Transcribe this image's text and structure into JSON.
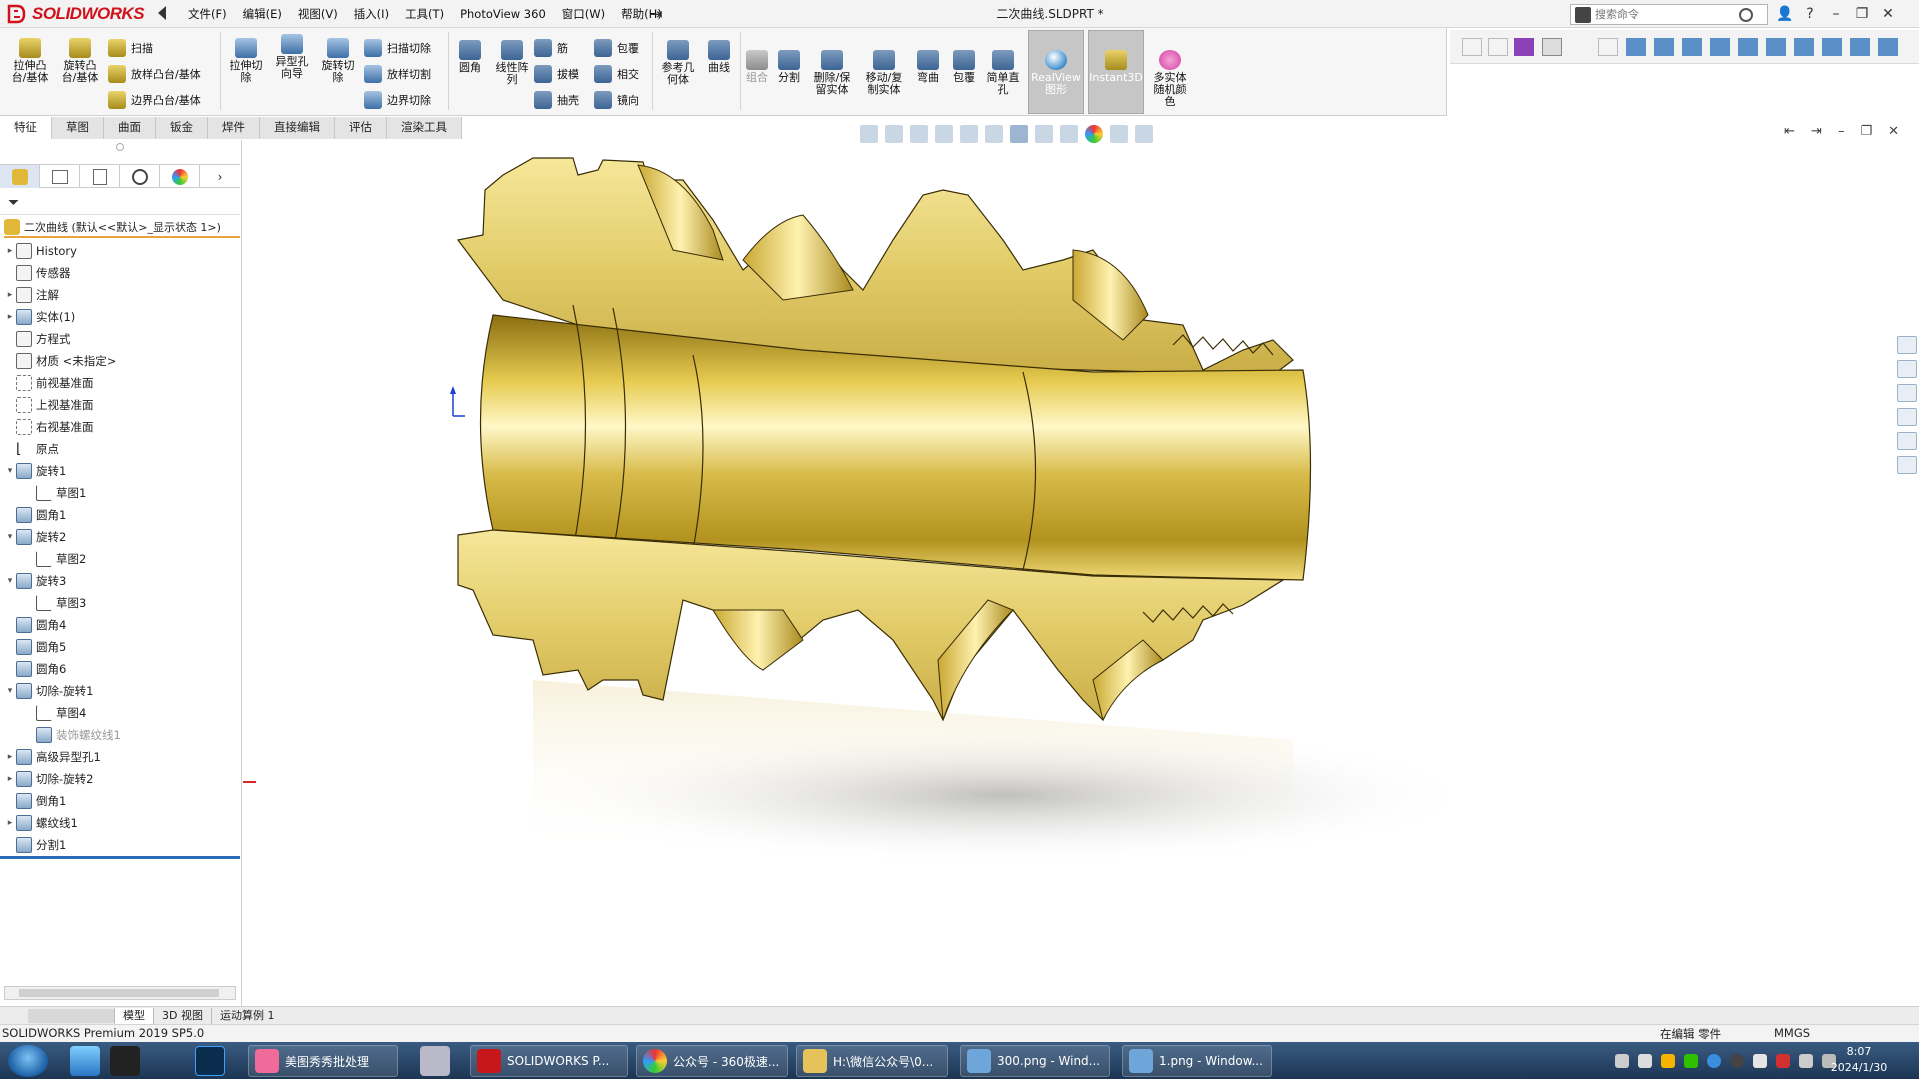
{
  "app": {
    "logo_text": "SOLIDWORKS",
    "doc_title": "二次曲线.SLDPRT *"
  },
  "menu": [
    "文件(F)",
    "编辑(E)",
    "视图(V)",
    "插入(I)",
    "工具(T)",
    "PhotoView 360",
    "窗口(W)",
    "帮助(H)"
  ],
  "search": {
    "placeholder": "搜索命令"
  },
  "commands": {
    "extrude_boss": "拉伸凸\n台/基体",
    "revolve_boss": "旋转凸\n台/基体",
    "sweep": "扫描",
    "loft": "放样凸台/基体",
    "boundary": "边界凸台/基体",
    "extrude_cut": "拉伸切\n除",
    "hole_wizard": "异型孔\n向导",
    "revolve_cut": "旋转切\n除",
    "sweep_cut": "扫描切除",
    "loft_cut": "放样切割",
    "boundary_cut": "边界切除",
    "fillet": "圆角",
    "linear_pattern": "线性阵\n列",
    "rib": "筋",
    "draft": "拔模",
    "shell": "抽壳",
    "wrap": "包覆",
    "intersect": "相交",
    "mirror": "镜向",
    "ref_geom": "参考几\n何体",
    "curves": "曲线",
    "combine": "组合",
    "split": "分割",
    "delete_body": "删除/保\n留实体",
    "move_copy": "移动/复\n制实体",
    "flex": "弯曲",
    "wrap2": "包覆",
    "simple_hole": "简单直\n孔",
    "realview": "RealView\n图形",
    "instant3d": "Instant3D",
    "random_color": "多实体\n随机颜\n色"
  },
  "cmd_tabs": [
    "特征",
    "草图",
    "曲面",
    "钣金",
    "焊件",
    "直接编辑",
    "评估",
    "渲染工具"
  ],
  "tree": {
    "root": "二次曲线 (默认<<默认>_显示状态 1>)",
    "items": [
      {
        "label": "History",
        "exp": "▸",
        "icon": "history-icon",
        "indent": 0
      },
      {
        "label": "传感器",
        "exp": "",
        "icon": "sensor-icon",
        "indent": 0
      },
      {
        "label": "注解",
        "exp": "▸",
        "icon": "annotation-icon",
        "indent": 0
      },
      {
        "label": "实体(1)",
        "exp": "▸",
        "icon": "solid-bodies-icon",
        "indent": 0
      },
      {
        "label": "方程式",
        "exp": "",
        "icon": "equation-icon",
        "indent": 0
      },
      {
        "label": "材质 <未指定>",
        "exp": "",
        "icon": "material-icon",
        "indent": 0
      },
      {
        "label": "前视基准面",
        "exp": "",
        "icon": "plane-icon",
        "indent": 0
      },
      {
        "label": "上视基准面",
        "exp": "",
        "icon": "plane-icon",
        "indent": 0
      },
      {
        "label": "右视基准面",
        "exp": "",
        "icon": "plane-icon",
        "indent": 0
      },
      {
        "label": "原点",
        "exp": "",
        "icon": "origin-icon",
        "indent": 0
      },
      {
        "label": "旋转1",
        "exp": "▾",
        "icon": "revolve-icon",
        "indent": 0
      },
      {
        "label": "草图1",
        "exp": "",
        "icon": "sketch-icon",
        "indent": 1
      },
      {
        "label": "圆角1",
        "exp": "",
        "icon": "fillet-icon",
        "indent": 0
      },
      {
        "label": "旋转2",
        "exp": "▾",
        "icon": "revolve-icon",
        "indent": 0
      },
      {
        "label": "草图2",
        "exp": "",
        "icon": "sketch-icon",
        "indent": 1
      },
      {
        "label": "旋转3",
        "exp": "▾",
        "icon": "revolve-icon",
        "indent": 0
      },
      {
        "label": "草图3",
        "exp": "",
        "icon": "sketch-icon",
        "indent": 1
      },
      {
        "label": "圆角4",
        "exp": "",
        "icon": "fillet-icon",
        "indent": 0
      },
      {
        "label": "圆角5",
        "exp": "",
        "icon": "fillet-icon",
        "indent": 0
      },
      {
        "label": "圆角6",
        "exp": "",
        "icon": "fillet-icon",
        "indent": 0
      },
      {
        "label": "切除-旋转1",
        "exp": "▾",
        "icon": "cut-revolve-icon",
        "indent": 0
      },
      {
        "label": "草图4",
        "exp": "",
        "icon": "sketch-icon",
        "indent": 1
      },
      {
        "label": "装饰螺纹线1",
        "exp": "",
        "icon": "cosmetic-thread-icon",
        "indent": 1,
        "muted": true
      },
      {
        "label": "高级异型孔1",
        "exp": "▸",
        "icon": "hole-icon",
        "indent": 0
      },
      {
        "label": "切除-旋转2",
        "exp": "▸",
        "icon": "cut-revolve-icon",
        "indent": 0
      },
      {
        "label": "倒角1",
        "exp": "",
        "icon": "chamfer-icon",
        "indent": 0
      },
      {
        "label": "螺纹线1",
        "exp": "▸",
        "icon": "thread-icon",
        "indent": 0
      },
      {
        "label": "分割1",
        "exp": "",
        "icon": "split-icon",
        "indent": 0
      }
    ]
  },
  "bottom_tabs": [
    "模型",
    "3D 视图",
    "运动算例 1"
  ],
  "status": {
    "left": "SOLIDWORKS Premium 2019 SP5.0",
    "edit": "在编辑 零件",
    "units": "MMGS"
  },
  "taskbar": {
    "apps": [
      "美图秀秀批处理",
      "SOLIDWORKS P...",
      "公众号 - 360极速...",
      "H:\\微信公众号\\0...",
      "300.png - Wind...",
      "1.png - Window..."
    ],
    "time": "8:07",
    "date": "2024/1/30"
  },
  "colors": {
    "brand_red": "#d0121b",
    "gold_light": "#f6e79a",
    "gold_mid": "#d8bb4a",
    "gold_dark": "#8a6e12",
    "tree_accent": "#e8a33c"
  }
}
